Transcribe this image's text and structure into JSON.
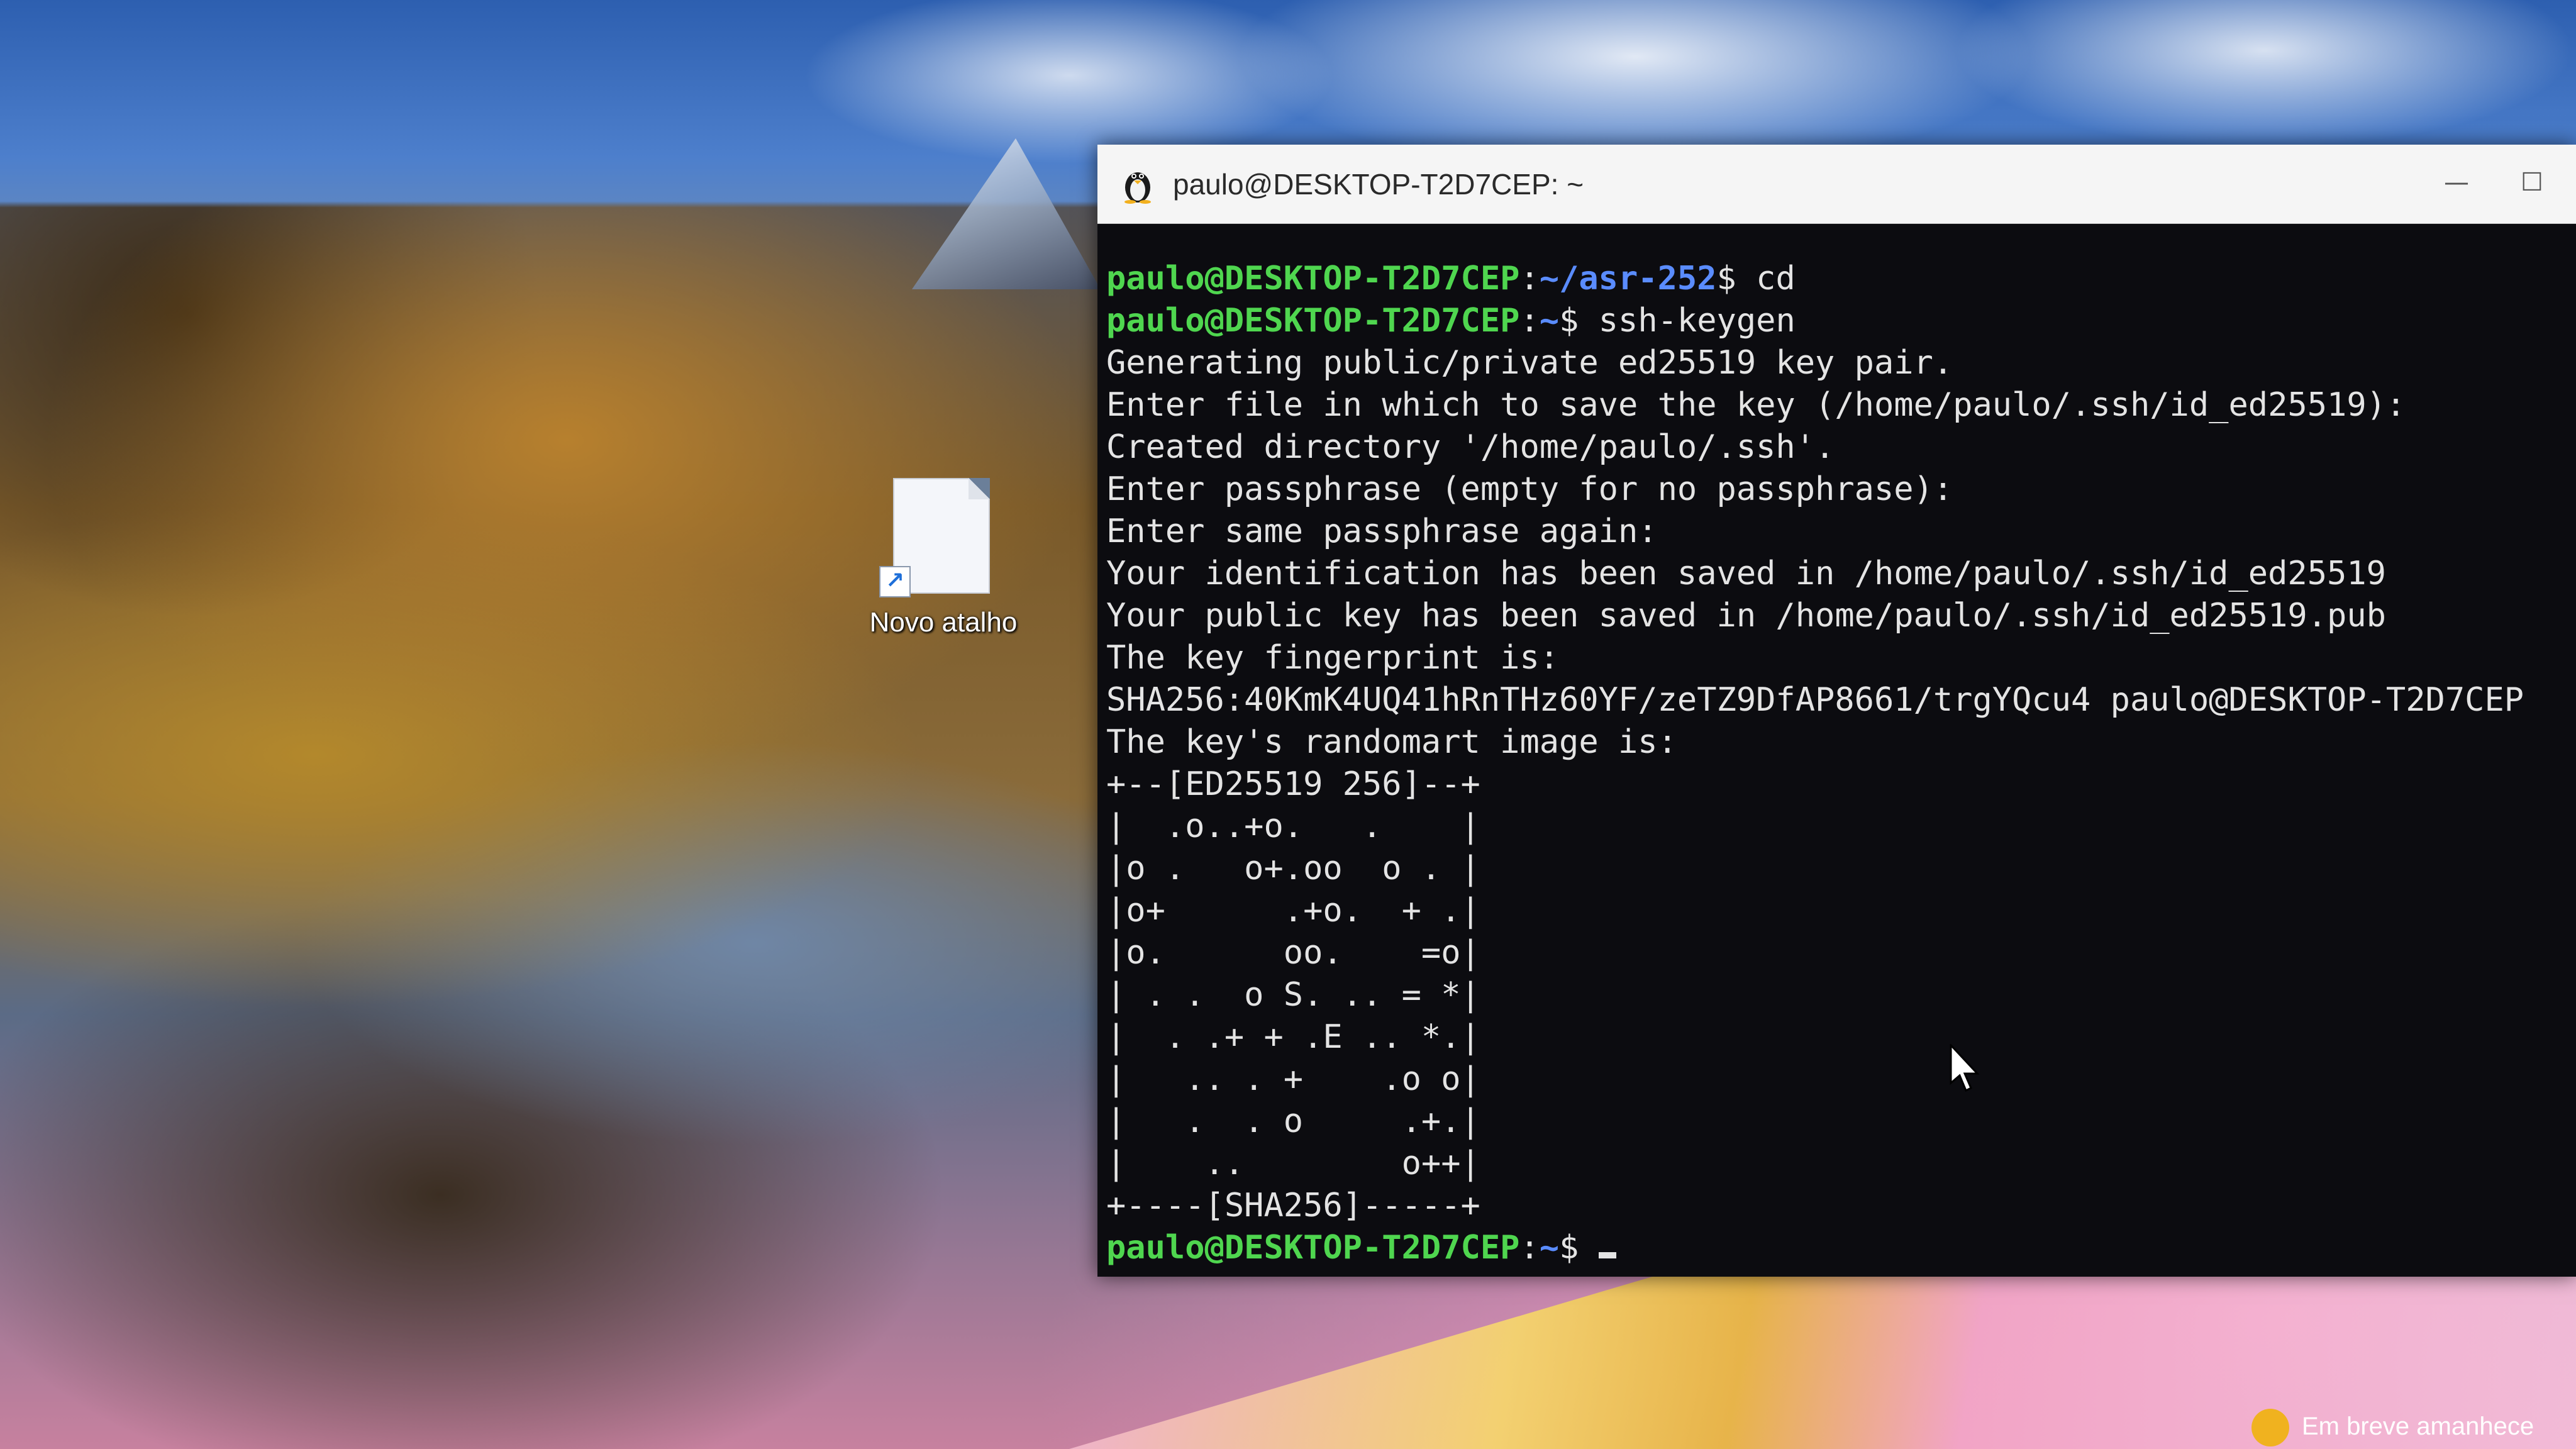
{
  "desktop": {
    "shortcut_label": "Novo atalho"
  },
  "terminal": {
    "title": "paulo@DESKTOP-T2D7CEP: ~",
    "controls": {
      "minimize": "—",
      "maximize": "☐"
    },
    "lines": [
      {
        "type": "prompt",
        "user": "paulo@DESKTOP-T2D7CEP",
        "sep": ":",
        "path": "~/asr-252",
        "sym": "$ ",
        "cmd": "cd"
      },
      {
        "type": "prompt",
        "user": "paulo@DESKTOP-T2D7CEP",
        "sep": ":",
        "path": "~",
        "sym": "$ ",
        "cmd": "ssh-keygen"
      },
      {
        "type": "out",
        "text": "Generating public/private ed25519 key pair."
      },
      {
        "type": "out",
        "text": "Enter file in which to save the key (/home/paulo/.ssh/id_ed25519):"
      },
      {
        "type": "out",
        "text": "Created directory '/home/paulo/.ssh'."
      },
      {
        "type": "out",
        "text": "Enter passphrase (empty for no passphrase):"
      },
      {
        "type": "out",
        "text": "Enter same passphrase again:"
      },
      {
        "type": "out",
        "text": "Your identification has been saved in /home/paulo/.ssh/id_ed25519"
      },
      {
        "type": "out",
        "text": "Your public key has been saved in /home/paulo/.ssh/id_ed25519.pub"
      },
      {
        "type": "out",
        "text": "The key fingerprint is:"
      },
      {
        "type": "out",
        "text": "SHA256:40KmK4UQ41hRnTHz60YF/zeTZ9DfAP8661/trgYQcu4 paulo@DESKTOP-T2D7CEP"
      },
      {
        "type": "out",
        "text": "The key's randomart image is:"
      },
      {
        "type": "out",
        "text": "+--[ED25519 256]--+"
      },
      {
        "type": "out",
        "text": "|  .o..+o.   .    |"
      },
      {
        "type": "out",
        "text": "|o .   o+.oo  o . |"
      },
      {
        "type": "out",
        "text": "|o+      .+o.  + .|"
      },
      {
        "type": "out",
        "text": "|o.      oo.    =o|"
      },
      {
        "type": "out",
        "text": "| . .  o S. .. = *|"
      },
      {
        "type": "out",
        "text": "|  . .+ + .E .. *.|"
      },
      {
        "type": "out",
        "text": "|   .. . +    .o o|"
      },
      {
        "type": "out",
        "text": "|   .  . o     .+.|"
      },
      {
        "type": "out",
        "text": "|    ..        o++|"
      },
      {
        "type": "out",
        "text": "+----[SHA256]-----+"
      },
      {
        "type": "prompt",
        "user": "paulo@DESKTOP-T2D7CEP",
        "sep": ":",
        "path": "~",
        "sym": "$ ",
        "cmd": ""
      }
    ]
  },
  "notification": {
    "text": "Em breve amanhece"
  },
  "colors": {
    "prompt_user": "#4fd64f",
    "prompt_path": "#5a8cff",
    "terminal_bg": "#0c0c10",
    "terminal_fg": "#e4e4e4"
  }
}
